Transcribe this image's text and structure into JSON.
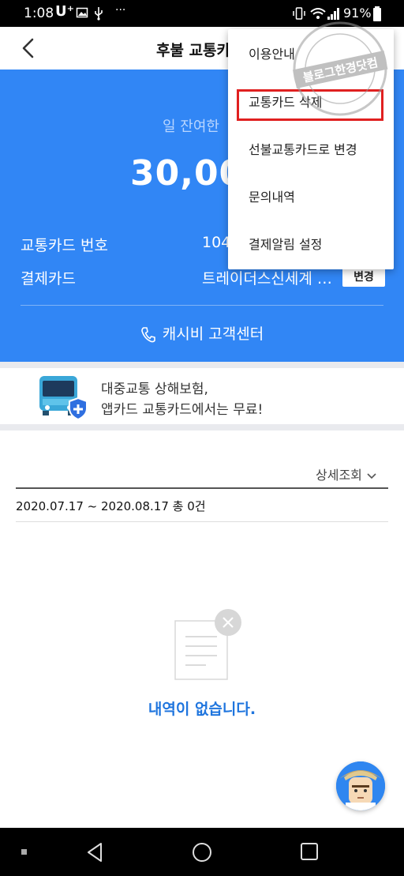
{
  "status_bar": {
    "time": "1:08",
    "carrier": "U⁺",
    "battery_percent": "91%",
    "icons": [
      "image-icon",
      "usb-icon",
      "more-dots-icon",
      "vibrate-icon",
      "wifi-icon",
      "signal-icon",
      "battery-icon"
    ]
  },
  "header": {
    "title": "후불 교통카",
    "back_icon": "back-arrow-icon"
  },
  "card": {
    "remaining_label": "일 잔여한",
    "amount": "30,000",
    "card_number_label": "교통카드 번호",
    "card_number_value": "104",
    "payment_card_label": "결제카드",
    "payment_card_value": "트레이더스신세계 …",
    "change_button": "변경",
    "customer_center": "캐시비 고객센터"
  },
  "banner": {
    "line1": "대중교통 상해보험,",
    "line2": "앱카드 교통카드에서는 무료!"
  },
  "history": {
    "detail_link": "상세조회",
    "period": "2020.07.17 ~ 2020.08.17  총 0건",
    "empty_message": "내역이 없습니다."
  },
  "menu": {
    "items": [
      {
        "label": "이용안내"
      },
      {
        "label": "교통카드 삭제"
      },
      {
        "label": "선불교통카드로 변경"
      },
      {
        "label": "문의내역"
      },
      {
        "label": "결제알림 설정"
      }
    ],
    "highlighted_index": 1
  },
  "watermark": {
    "text": "블로그한경닷컴"
  },
  "colors": {
    "primary_blue": "#3186f5",
    "empty_text_blue": "#1f75de",
    "highlight_red": "#e02020"
  }
}
